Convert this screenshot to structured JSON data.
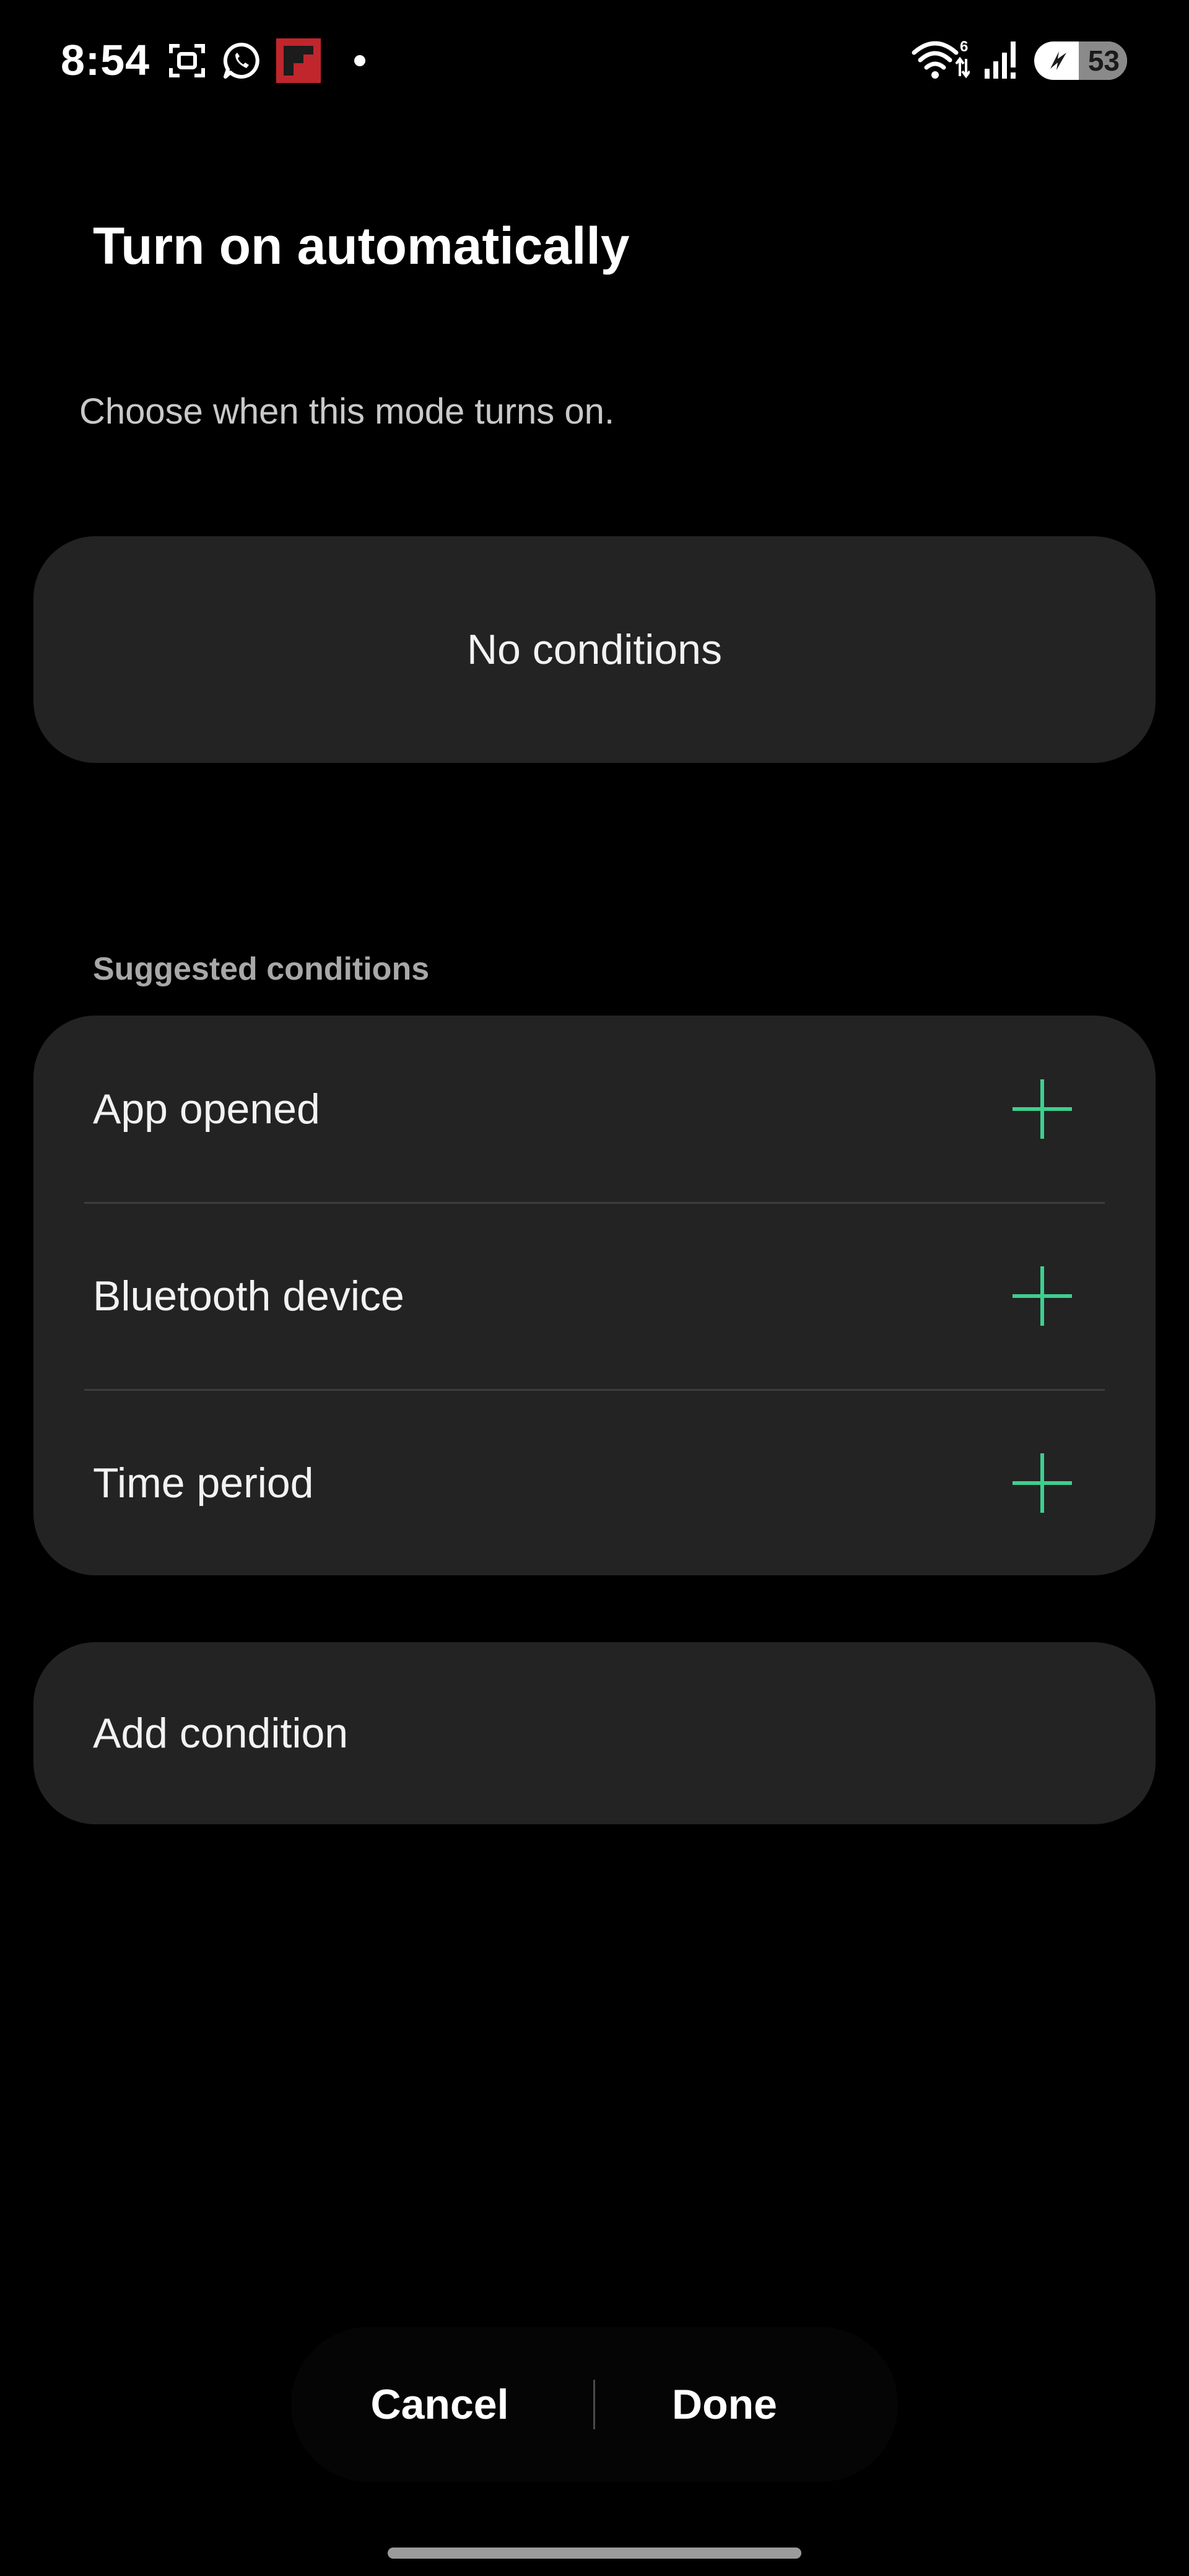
{
  "status_bar": {
    "time": "8:54",
    "left_icons": [
      "screenshot-icon",
      "whatsapp-icon",
      "flipboard-icon",
      "notification-dot"
    ],
    "right_icons": [
      "wifi-icon",
      "signal-icon",
      "battery-icon"
    ],
    "wifi_badge": "6",
    "battery_level": "53"
  },
  "header": {
    "title": "Turn on automatically",
    "subtitle": "Choose when this mode turns on."
  },
  "current_conditions": {
    "empty_label": "No conditions"
  },
  "suggested": {
    "section_label": "Suggested conditions",
    "items": [
      {
        "label": "App opened",
        "icon": "plus-icon"
      },
      {
        "label": "Bluetooth device",
        "icon": "plus-icon"
      },
      {
        "label": "Time period",
        "icon": "plus-icon"
      }
    ]
  },
  "add_condition": {
    "label": "Add condition"
  },
  "footer": {
    "cancel_label": "Cancel",
    "done_label": "Done"
  },
  "colors": {
    "background": "#000000",
    "card": "#232323",
    "accent_plus": "#3ecf8e",
    "flipboard_red": "#c0262c"
  }
}
